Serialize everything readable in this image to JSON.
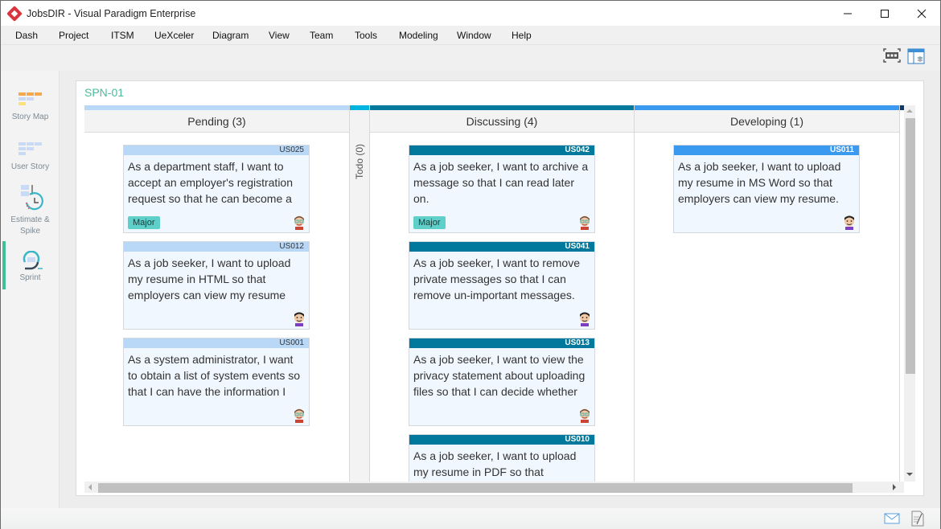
{
  "window": {
    "title": "JobsDIR - Visual Paradigm Enterprise",
    "controls": {
      "minimize": "—",
      "maximize": "☐",
      "close": "✕"
    }
  },
  "menubar": {
    "items": [
      "Dash",
      "Project",
      "ITSM",
      "UeXceler",
      "Diagram",
      "View",
      "Team",
      "Tools",
      "Modeling",
      "Window",
      "Help"
    ]
  },
  "toolbar": {
    "icons": [
      "fit-to-window-icon",
      "panel-layout-icon"
    ]
  },
  "leftnav": {
    "items": [
      {
        "label_lines": [
          "Story Map"
        ],
        "icon": "story-map-icon",
        "active": false
      },
      {
        "label_lines": [
          "User Story"
        ],
        "icon": "user-story-icon",
        "active": false
      },
      {
        "label_lines": [
          "Estimate &",
          "Spike"
        ],
        "icon": "estimate-spike-icon",
        "active": false
      },
      {
        "label_lines": [
          "Sprint"
        ],
        "icon": "sprint-icon",
        "active": true
      }
    ],
    "accent": "#3fbf97"
  },
  "sprint": {
    "title": "SPN-01",
    "columns": [
      {
        "name": "Pending",
        "header": "Pending (3)",
        "count": 3,
        "color": "#b9d8f7",
        "id_text_color": "#333333",
        "cards": [
          {
            "id": "US025",
            "text": "As a department staff, I want to accept an employer's registration request so that he can become a",
            "badge": "Major",
            "avatar": "avatar-glasses"
          },
          {
            "id": "US012",
            "text": "As a job seeker, I want to upload my resume in HTML so that employers can view my resume",
            "badge": null,
            "avatar": "avatar-purple"
          },
          {
            "id": "US001",
            "text": "As a system administrator, I want to obtain a list of system events so that I can have the information I",
            "badge": null,
            "avatar": "avatar-glasses"
          }
        ]
      },
      {
        "name": "Todo",
        "header": "Todo (0)",
        "count": 0,
        "color": "#00b4e0",
        "collapsed": true,
        "cards": []
      },
      {
        "name": "Discussing",
        "header": "Discussing (4)",
        "count": 4,
        "color": "#00799c",
        "id_text_color": "#ffffff",
        "cards": [
          {
            "id": "US042",
            "text": "As a job seeker, I want to archive a message so that I can read later on.",
            "badge": "Major",
            "avatar": "avatar-glasses"
          },
          {
            "id": "US041",
            "text": "As a job seeker, I want to remove private messages so that I can remove un-important messages.",
            "badge": null,
            "avatar": "avatar-purple"
          },
          {
            "id": "US013",
            "text": "As a job seeker, I want to view the privacy statement about uploading files so that I can decide whether",
            "badge": null,
            "avatar": "avatar-glasses"
          },
          {
            "id": "US010",
            "text": "As a job seeker, I want to upload my resume in PDF so that",
            "badge": null,
            "avatar": null
          }
        ]
      },
      {
        "name": "Developing",
        "header": "Developing (1)",
        "count": 1,
        "color": "#3a9af0",
        "id_text_color": "#ffffff",
        "cards": [
          {
            "id": "US011",
            "text": "As a job seeker, I want to upload my resume in MS Word so that employers can view my resume.",
            "badge": null,
            "avatar": "avatar-purple"
          }
        ]
      }
    ]
  },
  "statusbar": {
    "icons": [
      "mail-icon",
      "notes-icon"
    ]
  }
}
